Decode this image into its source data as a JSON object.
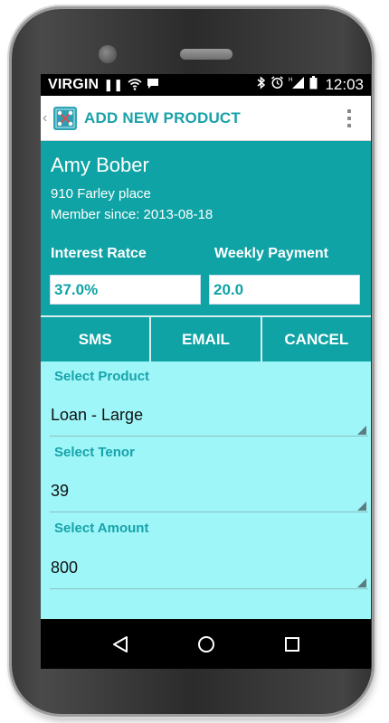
{
  "status_bar": {
    "carrier": "VIRGIN",
    "time": "12:03"
  },
  "app_bar": {
    "title": "ADD NEW PRODUCT"
  },
  "customer": {
    "name": "Amy Bober",
    "address": "910 Farley place",
    "member_since": "Member since: 2013-08-18"
  },
  "fields": {
    "interest_label": "Interest Ratce",
    "interest_value": "37.0%",
    "weekly_label": "Weekly Payment",
    "weekly_value": "20.0"
  },
  "actions": {
    "sms": "SMS",
    "email": "EMAIL",
    "cancel": "CANCEL"
  },
  "form": {
    "product_label": "Select Product",
    "product_value": "Loan - Large",
    "tenor_label": "Select Tenor",
    "tenor_value": "39",
    "amount_label": "Select Amount",
    "amount_value": "800"
  },
  "colors": {
    "primary": "#0fa3a5",
    "form_background": "#9ef6f8",
    "title_text": "#1aa1a9"
  }
}
